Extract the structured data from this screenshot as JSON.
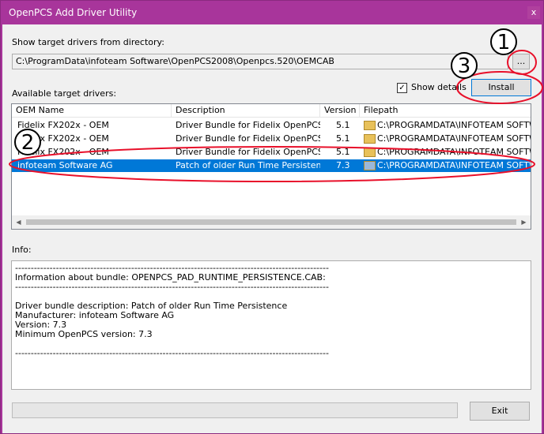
{
  "window": {
    "title": "OpenPCS Add Driver Utility",
    "close_label": "x"
  },
  "directory": {
    "label": "Show target drivers from directory:",
    "path": "C:\\ProgramData\\infoteam Software\\OpenPCS2008\\Openpcs.520\\OEMCAB",
    "browse_label": "..."
  },
  "drivers": {
    "label": "Available target drivers:",
    "show_details_label": "Show details",
    "show_details_checked": true,
    "install_label": "Install",
    "columns": [
      "OEM Name",
      "Description",
      "Version",
      "Filepath"
    ],
    "rows": [
      {
        "oem": "Fidelix FX202x - OEM",
        "description": "Driver Bundle for Fidelix OpenPCS ...",
        "version": "5.1",
        "filepath": "C:\\PROGRAMDATA\\INFOTEAM SOFTWA",
        "selected": false
      },
      {
        "oem": "Fidelix FX202x - OEM",
        "description": "Driver Bundle for Fidelix OpenPCS ...",
        "version": "5.1",
        "filepath": "C:\\PROGRAMDATA\\INFOTEAM SOFTWA",
        "selected": false
      },
      {
        "oem": "Fidelix FX202x - OEM",
        "description": "Driver Bundle for Fidelix OpenPCS ...",
        "version": "5.1",
        "filepath": "C:\\PROGRAMDATA\\INFOTEAM SOFTWA",
        "selected": false
      },
      {
        "oem": "infoteam Software AG",
        "description": "Patch of older Run Time Persistence",
        "version": "7.3",
        "filepath": "C:\\PROGRAMDATA\\INFOTEAM SOFTWA",
        "selected": true
      }
    ]
  },
  "info": {
    "label": "Info:",
    "text": "----------------------------------------------------------------------------------------------------\nInformation about bundle: OPENPCS_PAD_RUNTIME_PERSISTENCE.CAB:\n----------------------------------------------------------------------------------------------------\n\nDriver bundle description: Patch of older Run Time Persistence\nManufacturer: infoteam Software AG\nVersion: 7.3\nMinimum OpenPCS version: 7.3\n\n----------------------------------------------------------------------------------------------------"
  },
  "footer": {
    "exit_label": "Exit"
  },
  "annotations": {
    "badge1": "1",
    "badge2": "2",
    "badge3": "3",
    "color": "#e8102a"
  },
  "colors": {
    "titlebar": "#a8359b",
    "selection": "#0078d7"
  }
}
